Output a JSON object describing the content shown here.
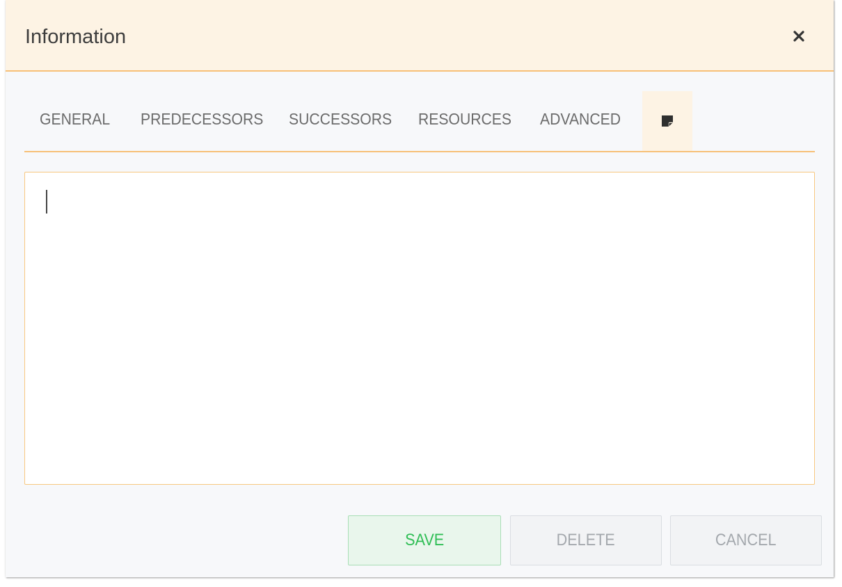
{
  "dialog": {
    "title": "Information"
  },
  "tabs": [
    {
      "label": "GENERAL"
    },
    {
      "label": "PREDECESSORS"
    },
    {
      "label": "SUCCESSORS"
    },
    {
      "label": "RESOURCES"
    },
    {
      "label": "ADVANCED"
    },
    {
      "label": "",
      "icon": "note-icon",
      "active": true
    }
  ],
  "notes": {
    "value": "",
    "placeholder": ""
  },
  "buttons": {
    "save": "SAVE",
    "delete": "DELETE",
    "cancel": "CANCEL"
  },
  "icons": {
    "close": "close-icon",
    "notes_tab": "note-icon"
  },
  "colors": {
    "accent": "#f7c077",
    "header_bg": "#fdf3e4",
    "save_text": "#2fbe55",
    "save_bg": "#e9f6ec",
    "disabled_text": "#a4a8ad"
  }
}
